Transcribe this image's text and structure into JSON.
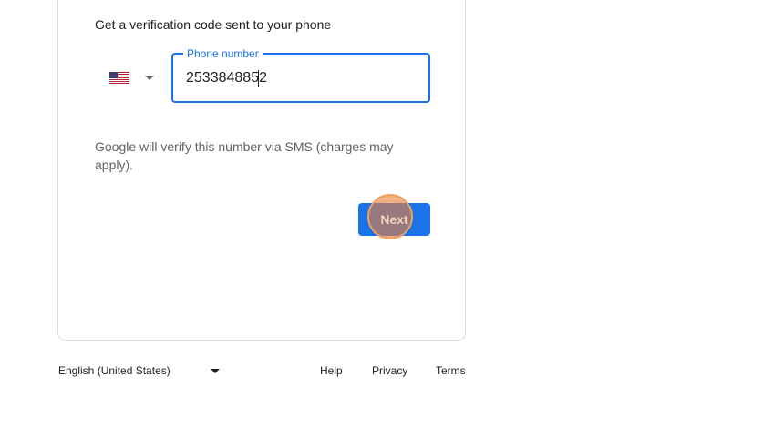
{
  "verification": {
    "intro": "Get a verification code sent to your phone",
    "country": {
      "flag_icon": "us-flag-icon",
      "caret_icon": "chevron-down-icon"
    },
    "phone": {
      "label": "Phone number",
      "value": "2533848852"
    },
    "note": "Google will verify this number via SMS (charges may apply).",
    "next_label": "Next"
  },
  "footer": {
    "language": "English (United States)",
    "links": [
      "Help",
      "Privacy",
      "Terms"
    ]
  },
  "colors": {
    "accent": "#1a73e8",
    "click_marker": "#f0a05c"
  }
}
